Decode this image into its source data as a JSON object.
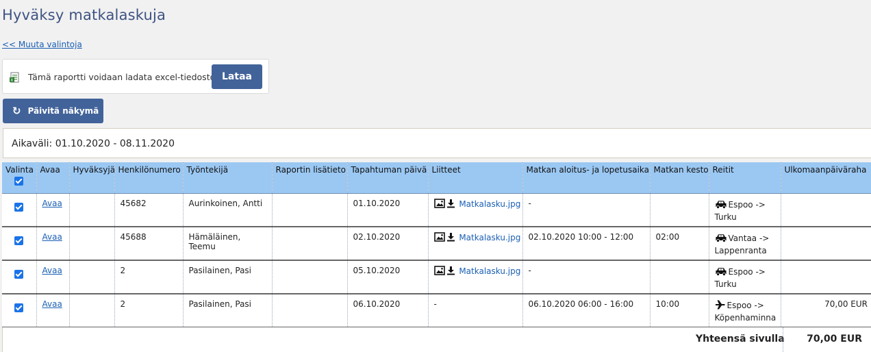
{
  "page": {
    "title": "Hyväksy matkalaskuja",
    "back_link": "<< Muuta valintoja"
  },
  "excel": {
    "text": "Tämä raportti voidaan ladata excel-tiedostona",
    "button": "Lataa",
    "icon": "excel-file-icon"
  },
  "refresh": {
    "button": "Päivitä näkymä",
    "icon": "refresh-icon"
  },
  "period": {
    "text": "Aikaväli: 01.10.2020 - 08.11.2020"
  },
  "table": {
    "headers": [
      "Valinta",
      "Avaa",
      "Hyväksyjä",
      "Henkilönumero",
      "Työntekijä",
      "Raportin lisätieto",
      "Tapahtuman päivä",
      "Liitteet",
      "Matkan aloitus- ja lopetusaika",
      "Matkan kesto",
      "Reitit",
      "Ulkomaanpäiväraha"
    ],
    "header_checkbox_checked": true,
    "rows": [
      {
        "checked": true,
        "open": "Avaa",
        "approver": "",
        "person_no": "45682",
        "employee": "Aurinkoinen, Antti",
        "info": "",
        "date": "01.10.2020",
        "attachment": "Matkalasku.jpg",
        "time": "-",
        "duration": "",
        "route_icon": "car-icon",
        "route_line1": "Espoo ->",
        "route_line2": "Turku",
        "allowance": ""
      },
      {
        "checked": true,
        "open": "Avaa",
        "approver": "",
        "person_no": "45688",
        "employee": "Hämäläinen, Teemu",
        "info": "",
        "date": "02.10.2020",
        "attachment": "Matkalasku.jpg",
        "time": "02.10.2020 10:00 - 12:00",
        "duration": "02:00",
        "route_icon": "car-icon",
        "route_line1": "Vantaa ->",
        "route_line2": "Lappenranta",
        "allowance": ""
      },
      {
        "checked": true,
        "open": "Avaa",
        "approver": "",
        "person_no": "2",
        "employee": "Pasilainen, Pasi",
        "info": "",
        "date": "05.10.2020",
        "attachment": "Matkalasku.jpg",
        "time": "-",
        "duration": "",
        "route_icon": "car-icon",
        "route_line1": "Espoo ->",
        "route_line2": "Turku",
        "allowance": ""
      },
      {
        "checked": true,
        "open": "Avaa",
        "approver": "",
        "person_no": "2",
        "employee": "Pasilainen, Pasi",
        "info": "",
        "date": "06.10.2020",
        "attachment_text": "-",
        "time": "06.10.2020 06:00 - 16:00",
        "duration": "10:00",
        "route_icon": "airplane-icon",
        "route_line1": "Espoo ->",
        "route_line2": "Köpenhaminna",
        "allowance": "70,00 EUR"
      }
    ],
    "footer_label": "Yhteensä sivulla",
    "footer_total": "70,00 EUR"
  },
  "colors": {
    "title": "#3d5382",
    "button": "#42639a",
    "header_bg": "#9bc8f3",
    "link": "#1a5fb4",
    "checkbox": "#1a73e8"
  }
}
